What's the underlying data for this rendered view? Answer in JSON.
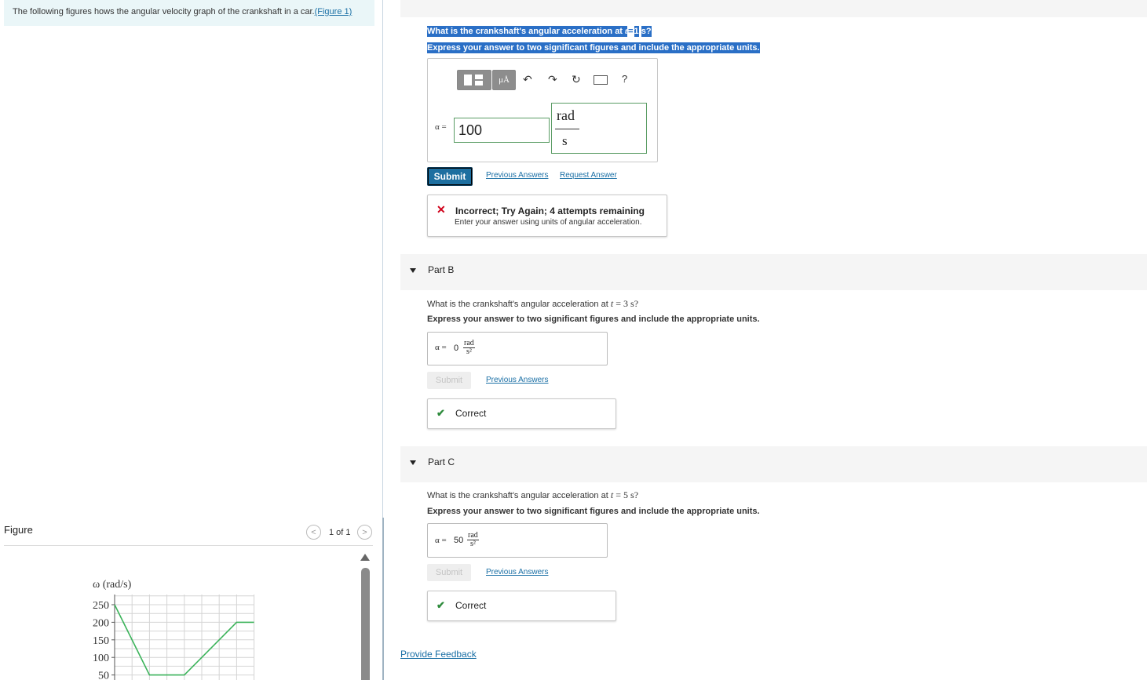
{
  "left": {
    "intro_text": "The following figures hows the angular velocity graph of the crankshaft in a car.",
    "intro_link": "(Figure 1)",
    "figure_title": "Figure",
    "pager_text": "1 of 1",
    "prev_glyph": "<",
    "next_glyph": ">"
  },
  "chart_data": {
    "type": "line",
    "ylabel": "ω (rad/s)",
    "yticks": [
      "250",
      "200",
      "150",
      "100",
      "50"
    ],
    "ytick_values": [
      250,
      200,
      150,
      100,
      50
    ],
    "series": [
      {
        "x": [
          0,
          2,
          4,
          7,
          8
        ],
        "y": [
          250,
          50,
          50,
          200,
          200
        ],
        "color": "#3bb35a"
      }
    ],
    "grid": true
  },
  "partA": {
    "question_prefix": "What is the crankshaft's angular acceleration at",
    "question_var": "t",
    "question_eq": "=",
    "question_val": "1",
    "question_unit": "s?",
    "instruction": "Express your answer to two significant figures and include the appropriate units.",
    "toolbar": {
      "mu_label": "μÅ",
      "help_label": "?"
    },
    "alpha_label": "α =",
    "value_input": "100",
    "unit_num": "rad",
    "unit_den": "s",
    "submit_label": "Submit",
    "prev_answers": "Previous Answers",
    "request_answer": "Request Answer",
    "feedback_title": "Incorrect; Try Again; 4 attempts remaining",
    "feedback_body": "Enter your answer using units of angular acceleration.",
    "error_glyph": "✕"
  },
  "partB": {
    "label": "Part B",
    "question_prefix": "What is the crankshaft's angular acceleration at",
    "question_var": "t",
    "question_rest": "= 3 s?",
    "instruction": "Express your answer to two significant figures and include the appropriate units.",
    "alpha_label": "α =",
    "answer_value": "0",
    "unit_num": "rad",
    "unit_den": "s²",
    "submit_label": "Submit",
    "prev_answers": "Previous Answers",
    "result": "Correct",
    "check_glyph": "✔"
  },
  "partC": {
    "label": "Part C",
    "question_prefix": "What is the crankshaft's angular acceleration at",
    "question_var": "t",
    "question_rest": "= 5 s?",
    "instruction": "Express your answer to two significant figures and include the appropriate units.",
    "alpha_label": "α =",
    "answer_value": "50",
    "unit_num": "rad",
    "unit_den": "s²",
    "submit_label": "Submit",
    "prev_answers": "Previous Answers",
    "result": "Correct",
    "check_glyph": "✔"
  },
  "footer": {
    "provide_feedback": "Provide Feedback"
  }
}
